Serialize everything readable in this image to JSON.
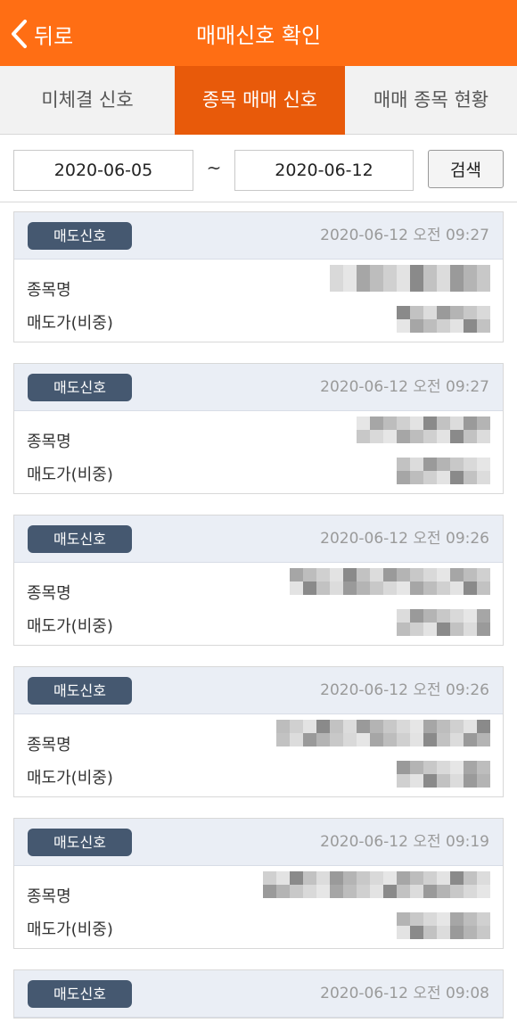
{
  "header": {
    "back_label": "뒤로",
    "title": "매매신호 확인"
  },
  "tabs": [
    {
      "label": "미체결 신호",
      "active": false
    },
    {
      "label": "종목 매매 신호",
      "active": true
    },
    {
      "label": "매매 종목 현황",
      "active": false
    }
  ],
  "search": {
    "date_from": "2020-06-05",
    "separator": "~",
    "date_to": "2020-06-12",
    "button_label": "검색"
  },
  "labels": {
    "stock_name": "종목명",
    "sell_price": "매도가(비중)"
  },
  "signals": [
    {
      "badge": "매도신호",
      "time": "2020-06-12 오전 09:27"
    },
    {
      "badge": "매도신호",
      "time": "2020-06-12 오전 09:27"
    },
    {
      "badge": "매도신호",
      "time": "2020-06-12 오전 09:26"
    },
    {
      "badge": "매도신호",
      "time": "2020-06-12 오전 09:26"
    },
    {
      "badge": "매도신호",
      "time": "2020-06-12 오전 09:19"
    },
    {
      "badge": "매도신호",
      "time": "2020-06-12 오전 09:08"
    }
  ],
  "colors": {
    "header_bg": "#ff6e14",
    "active_tab_bg": "#e85a0a",
    "badge_bg": "#455870",
    "card_head_bg": "#eaeef5"
  }
}
